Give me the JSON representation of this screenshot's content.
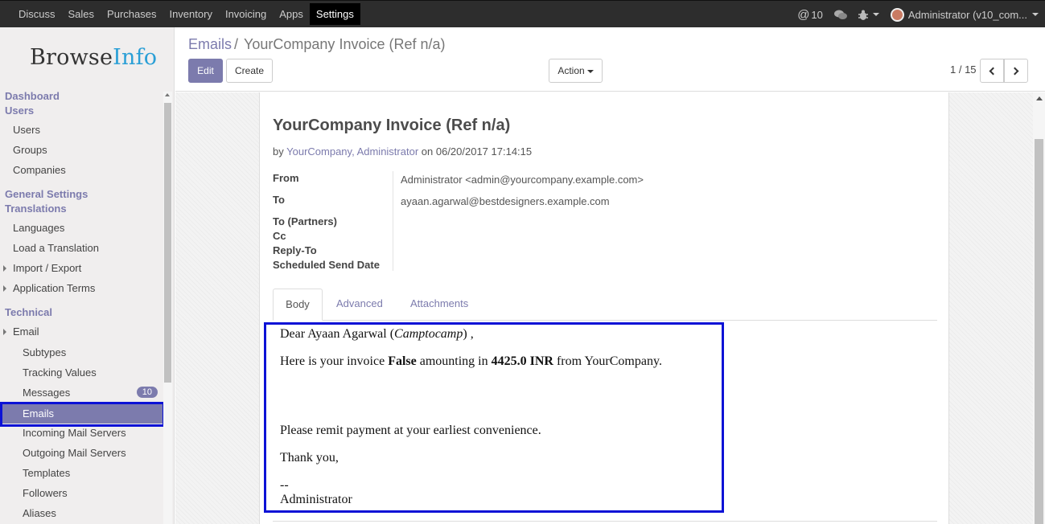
{
  "topbar": {
    "menu": [
      "Discuss",
      "Sales",
      "Purchases",
      "Inventory",
      "Invoicing",
      "Apps",
      "Settings"
    ],
    "active_menu": "Settings",
    "mentions_count": "10",
    "user_label": "Administrator (v10_com..."
  },
  "logo": {
    "part1": "Browse",
    "part2": "Info"
  },
  "sidebar": {
    "dashboard": "Dashboard",
    "users_head": "Users",
    "users": "Users",
    "groups": "Groups",
    "companies": "Companies",
    "general_settings": "General Settings",
    "translations_head": "Translations",
    "languages": "Languages",
    "load_translation": "Load a Translation",
    "import_export": "Import / Export",
    "application_terms": "Application Terms",
    "technical": "Technical",
    "email": "Email",
    "subtypes": "Subtypes",
    "tracking_values": "Tracking Values",
    "messages": "Messages",
    "messages_badge": "10",
    "emails": "Emails",
    "incoming_mail_servers": "Incoming Mail Servers",
    "outgoing_mail_servers": "Outgoing Mail Servers",
    "templates": "Templates",
    "followers": "Followers",
    "aliases": "Aliases"
  },
  "control": {
    "breadcrumb_link": "Emails",
    "breadcrumb_sep": "/",
    "breadcrumb_current": "YourCompany Invoice (Ref n/a)",
    "edit_label": "Edit",
    "create_label": "Create",
    "action_label": "Action",
    "pager_text": "1 / 15"
  },
  "record": {
    "subject": "YourCompany Invoice (Ref n/a)",
    "by_prefix": "by",
    "authors": "YourCompany, Administrator",
    "on_text": "on 06/20/2017 17:14:15",
    "fields": {
      "from_label": "From",
      "from_value": "Administrator <admin@yourcompany.example.com>",
      "to_label": "To",
      "to_value": "ayaan.agarwal@bestdesigners.example.com",
      "to_partners_label": "To (Partners)",
      "cc_label": "Cc",
      "reply_to_label": "Reply-To",
      "scheduled_label": "Scheduled Send Date"
    },
    "tabs": [
      "Body",
      "Advanced",
      "Attachments"
    ],
    "body": {
      "greeting_prefix": "Dear Ayaan Agarwal (",
      "greeting_company": "Camptocamp",
      "greeting_suffix": ") ,",
      "line2_prefix": "Here is your invoice ",
      "line2_invoice": "False",
      "line2_mid": " amounting in ",
      "line2_amount": "4425.0 INR",
      "line2_suffix": " from YourCompany.",
      "line3": "Please remit payment at your earliest convenience.",
      "line4": "Thank you,",
      "sig_sep": "--",
      "signature": "Administrator"
    }
  },
  "colors": {
    "brand": "#7c7bad",
    "highlight": "#0c12d6",
    "topbar": "#2d2d2d"
  }
}
